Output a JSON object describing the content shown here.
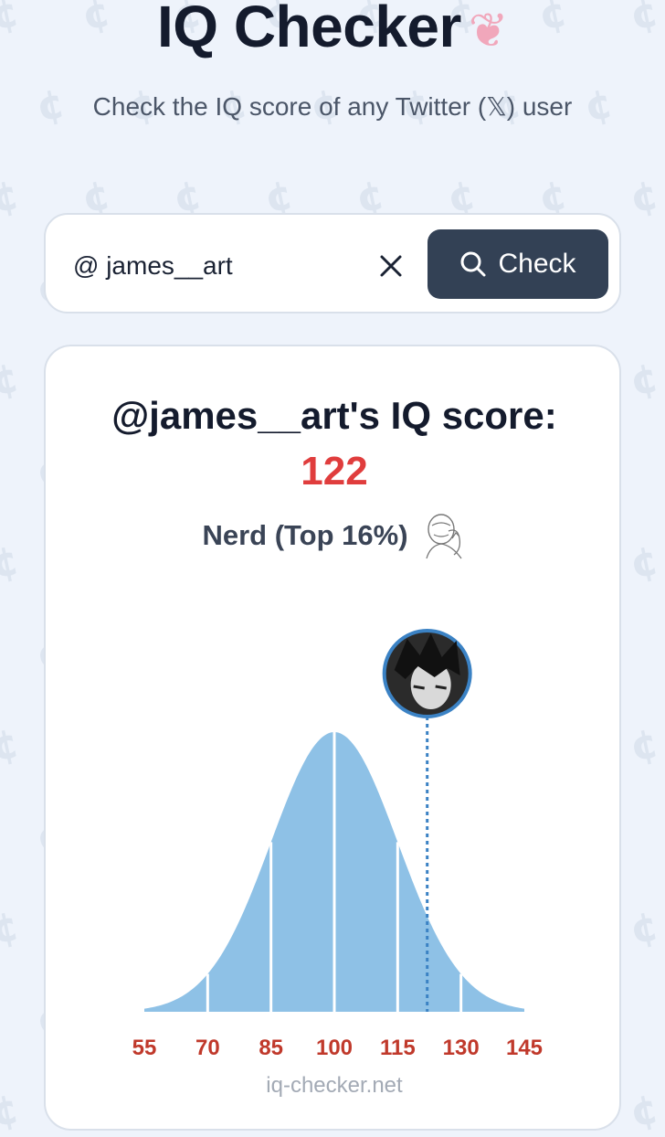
{
  "header": {
    "title": "IQ Checker",
    "subtitle": "Check the IQ score of any Twitter (𝕏) user"
  },
  "search": {
    "value": "@ james__art",
    "check_label": "Check"
  },
  "result": {
    "heading": "@james__art's IQ score:",
    "score": "122",
    "category": "Nerd (Top 16%)"
  },
  "chart_data": {
    "type": "area",
    "distribution": "normal",
    "mean": 100,
    "sd": 15,
    "x_ticks": [
      55,
      70,
      85,
      100,
      115,
      130,
      145
    ],
    "xlim": [
      55,
      145
    ],
    "marker_x": 122,
    "fill_color": "#8ec1e6",
    "marker_color": "#3b82c4",
    "tick_color": "#c0392b"
  },
  "footer": {
    "site": "iq-checker.net"
  },
  "colors": {
    "background": "#eef3fb",
    "score": "#e03d3d",
    "button": "#334155"
  }
}
